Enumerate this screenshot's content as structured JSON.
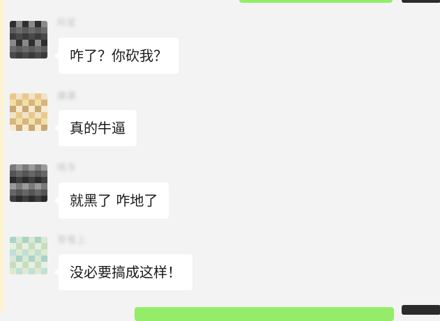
{
  "colors": {
    "chat_background": "#f3f3f3",
    "incoming_bubble": "#ffffff",
    "outgoing_bubble": "#95ec69",
    "message_text": "#191919",
    "sender_name_blurred": "#c6c6c6"
  },
  "messages": [
    {
      "sender": "阿星",
      "text": "咋了？你砍我？",
      "avatar": {
        "icon": "blurred-dark-avatar-icon",
        "colors": [
          "#2e2e2e",
          "#4a4a4a",
          "#6b6b6b",
          "#8a8a8a",
          "#3b3b3b",
          "#5c5c5c"
        ]
      }
    },
    {
      "sender": "康康",
      "text": "真的牛逼",
      "avatar": {
        "icon": "blurred-light-avatar-icon",
        "colors": [
          "#f2dfa8",
          "#e9c98a",
          "#f7ead0",
          "#d8b57a",
          "#efe3c9",
          "#c9a873"
        ]
      }
    },
    {
      "sender": "晓东",
      "text": "就黑了 咋地了",
      "avatar": {
        "icon": "blurred-dark-avatar-icon",
        "colors": [
          "#2b2b2b",
          "#555555",
          "#7a7a7a",
          "#3f3f3f",
          "#666666",
          "#9a9a9a"
        ]
      }
    },
    {
      "sender": "草莓上",
      "text": "没必要搞成这样！",
      "avatar": {
        "icon": "blurred-pastel-avatar-icon",
        "colors": [
          "#d7e8d4",
          "#bfe0d8",
          "#e8efe0",
          "#a9d3c5",
          "#dfe9cf",
          "#c8ddbf"
        ]
      }
    }
  ]
}
